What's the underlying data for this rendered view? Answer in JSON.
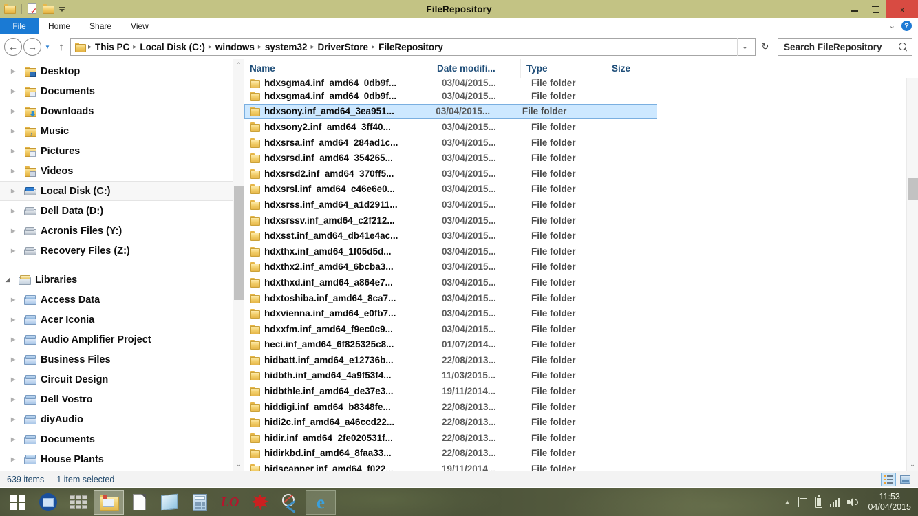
{
  "window": {
    "title": "FileRepository",
    "quick_access": [
      {
        "name": "folder-icon",
        "label": "Folder"
      },
      {
        "name": "properties-icon",
        "label": "Properties"
      },
      {
        "name": "new-folder-icon",
        "label": "New folder"
      },
      {
        "name": "customize-qat-icon",
        "label": "Customize Quick Access Toolbar"
      }
    ],
    "controls": {
      "minimize": "Minimize",
      "maximize": "Restore Down",
      "close": "x"
    }
  },
  "ribbon": {
    "tabs": [
      {
        "label": "File",
        "active": true
      },
      {
        "label": "Home",
        "active": false
      },
      {
        "label": "Share",
        "active": false
      },
      {
        "label": "View",
        "active": false
      }
    ],
    "expand_label": "Expand the Ribbon",
    "help_label": "?"
  },
  "address": {
    "back": "←",
    "forward": "→",
    "recent": "▾",
    "up": "↑",
    "crumbs": [
      "This PC",
      "Local Disk (C:)",
      "windows",
      "system32",
      "DriverStore",
      "FileRepository"
    ],
    "separator": "▸",
    "dropdown": "⌄",
    "refresh": "↻"
  },
  "search": {
    "placeholder": "Search FileRepository",
    "value": "Search FileRepository"
  },
  "sidebar": {
    "items": [
      {
        "label": "Desktop",
        "icon": "desktop-folder-icon",
        "arrow": true,
        "selected": false,
        "indent": 0
      },
      {
        "label": "Documents",
        "icon": "documents-folder-icon",
        "arrow": true,
        "selected": false,
        "indent": 0
      },
      {
        "label": "Downloads",
        "icon": "downloads-folder-icon",
        "arrow": true,
        "selected": false,
        "indent": 0
      },
      {
        "label": "Music",
        "icon": "music-folder-icon",
        "arrow": true,
        "selected": false,
        "indent": 0
      },
      {
        "label": "Pictures",
        "icon": "pictures-folder-icon",
        "arrow": true,
        "selected": false,
        "indent": 0
      },
      {
        "label": "Videos",
        "icon": "videos-folder-icon",
        "arrow": true,
        "selected": false,
        "indent": 0
      },
      {
        "label": "Local Disk (C:)",
        "icon": "system-drive-icon",
        "arrow": true,
        "selected": true,
        "indent": 0
      },
      {
        "label": "Dell Data (D:)",
        "icon": "drive-icon",
        "arrow": true,
        "selected": false,
        "indent": 0
      },
      {
        "label": "Acronis Files (Y:)",
        "icon": "drive-icon",
        "arrow": true,
        "selected": false,
        "indent": 0
      },
      {
        "label": "Recovery Files (Z:)",
        "icon": "drive-icon",
        "arrow": true,
        "selected": false,
        "indent": 0
      }
    ],
    "libraries_header": {
      "label": "Libraries",
      "icon": "libraries-icon",
      "arrow": "open"
    },
    "libraries": [
      {
        "label": "Access Data",
        "icon": "library-icon"
      },
      {
        "label": "Acer Iconia",
        "icon": "library-icon"
      },
      {
        "label": "Audio Amplifier Project",
        "icon": "library-icon"
      },
      {
        "label": "Business Files",
        "icon": "library-icon"
      },
      {
        "label": "Circuit Design",
        "icon": "library-icon"
      },
      {
        "label": "Dell Vostro",
        "icon": "library-icon"
      },
      {
        "label": "diyAudio",
        "icon": "library-icon"
      },
      {
        "label": "Documents",
        "icon": "library-icon"
      },
      {
        "label": "House Plants",
        "icon": "library-icon"
      }
    ]
  },
  "filelist": {
    "columns": [
      {
        "label": "Name",
        "key": "name"
      },
      {
        "label": "Date modifi...",
        "key": "date"
      },
      {
        "label": "Type",
        "key": "type"
      },
      {
        "label": "Size",
        "key": "size"
      }
    ],
    "rows": [
      {
        "name": "hdxsgma4.inf_amd64_0db9f...",
        "date": "03/04/2015...",
        "type": "File folder",
        "size": "",
        "selected": false
      },
      {
        "name": "hdxsony.inf_amd64_3ea951...",
        "date": "03/04/2015...",
        "type": "File folder",
        "size": "",
        "selected": true
      },
      {
        "name": "hdxsony2.inf_amd64_3ff40...",
        "date": "03/04/2015...",
        "type": "File folder",
        "size": "",
        "selected": false
      },
      {
        "name": "hdxsrsa.inf_amd64_284ad1c...",
        "date": "03/04/2015...",
        "type": "File folder",
        "size": "",
        "selected": false
      },
      {
        "name": "hdxsrsd.inf_amd64_354265...",
        "date": "03/04/2015...",
        "type": "File folder",
        "size": "",
        "selected": false
      },
      {
        "name": "hdxsrsd2.inf_amd64_370ff5...",
        "date": "03/04/2015...",
        "type": "File folder",
        "size": "",
        "selected": false
      },
      {
        "name": "hdxsrsl.inf_amd64_c46e6e0...",
        "date": "03/04/2015...",
        "type": "File folder",
        "size": "",
        "selected": false
      },
      {
        "name": "hdxsrss.inf_amd64_a1d2911...",
        "date": "03/04/2015...",
        "type": "File folder",
        "size": "",
        "selected": false
      },
      {
        "name": "hdxsrssv.inf_amd64_c2f212...",
        "date": "03/04/2015...",
        "type": "File folder",
        "size": "",
        "selected": false
      },
      {
        "name": "hdxsst.inf_amd64_db41e4ac...",
        "date": "03/04/2015...",
        "type": "File folder",
        "size": "",
        "selected": false
      },
      {
        "name": "hdxthx.inf_amd64_1f05d5d...",
        "date": "03/04/2015...",
        "type": "File folder",
        "size": "",
        "selected": false
      },
      {
        "name": "hdxthx2.inf_amd64_6bcba3...",
        "date": "03/04/2015...",
        "type": "File folder",
        "size": "",
        "selected": false
      },
      {
        "name": "hdxthxd.inf_amd64_a864e7...",
        "date": "03/04/2015...",
        "type": "File folder",
        "size": "",
        "selected": false
      },
      {
        "name": "hdxtoshiba.inf_amd64_8ca7...",
        "date": "03/04/2015...",
        "type": "File folder",
        "size": "",
        "selected": false
      },
      {
        "name": "hdxvienna.inf_amd64_e0fb7...",
        "date": "03/04/2015...",
        "type": "File folder",
        "size": "",
        "selected": false
      },
      {
        "name": "hdxxfm.inf_amd64_f9ec0c9...",
        "date": "03/04/2015...",
        "type": "File folder",
        "size": "",
        "selected": false
      },
      {
        "name": "heci.inf_amd64_6f825325c8...",
        "date": "01/07/2014...",
        "type": "File folder",
        "size": "",
        "selected": false
      },
      {
        "name": "hidbatt.inf_amd64_e12736b...",
        "date": "22/08/2013...",
        "type": "File folder",
        "size": "",
        "selected": false
      },
      {
        "name": "hidbth.inf_amd64_4a9f53f4...",
        "date": "11/03/2015...",
        "type": "File folder",
        "size": "",
        "selected": false
      },
      {
        "name": "hidbthle.inf_amd64_de37e3...",
        "date": "19/11/2014...",
        "type": "File folder",
        "size": "",
        "selected": false
      },
      {
        "name": "hiddigi.inf_amd64_b8348fe...",
        "date": "22/08/2013...",
        "type": "File folder",
        "size": "",
        "selected": false
      },
      {
        "name": "hidi2c.inf_amd64_a46ccd22...",
        "date": "22/08/2013...",
        "type": "File folder",
        "size": "",
        "selected": false
      },
      {
        "name": "hidir.inf_amd64_2fe020531f...",
        "date": "22/08/2013...",
        "type": "File folder",
        "size": "",
        "selected": false
      },
      {
        "name": "hidirkbd.inf_amd64_8faa33...",
        "date": "22/08/2013...",
        "type": "File folder",
        "size": "",
        "selected": false
      },
      {
        "name": "hidscanner.inf_amd64_f022...",
        "date": "19/11/2014...",
        "type": "File folder",
        "size": "",
        "selected": false
      }
    ]
  },
  "status": {
    "item_count": "639 items",
    "selection": "1 item selected",
    "views": [
      {
        "name": "details-view-button",
        "label": "Details view",
        "active": true
      },
      {
        "name": "large-icons-view-button",
        "label": "Large icons view",
        "active": false
      }
    ]
  },
  "taskbar": {
    "buttons": [
      {
        "name": "start-button",
        "label": "Start",
        "active": false
      },
      {
        "name": "network-app-button",
        "label": "Network",
        "active": false
      },
      {
        "name": "bricks-app-button",
        "label": "Application",
        "active": false
      },
      {
        "name": "file-explorer-button",
        "label": "File Explorer",
        "active": true
      },
      {
        "name": "document-app-button",
        "label": "Document",
        "active": false
      },
      {
        "name": "notepad-app-button",
        "label": "Notepad",
        "active": false
      },
      {
        "name": "calculator-app-button",
        "label": "Calculator",
        "active": false
      },
      {
        "name": "libreoffice-button",
        "label": "LibreOffice",
        "active": false
      },
      {
        "name": "paint-app-button",
        "label": "Paint",
        "active": false
      },
      {
        "name": "snipping-tool-button",
        "label": "Snipping Tool",
        "active": false
      },
      {
        "name": "internet-explorer-button",
        "label": "Internet Explorer",
        "active": true
      }
    ],
    "tray": [
      {
        "name": "show-hidden-icons",
        "glyph": "▲"
      },
      {
        "name": "action-center-flag-icon"
      },
      {
        "name": "battery-icon"
      },
      {
        "name": "network-signal-icon"
      },
      {
        "name": "volume-icon"
      }
    ],
    "clock": {
      "time": "11:53",
      "date": "04/04/2015"
    }
  },
  "colors": {
    "titlebar": "#c3c384",
    "file_tab": "#1a7ad4",
    "selection": "#cde8ff",
    "selection_border": "#7aafe0",
    "column_header_text": "#1f4e79",
    "status_text": "#20486b",
    "close_button": "#d84b42",
    "taskbar": "#4a5038"
  }
}
